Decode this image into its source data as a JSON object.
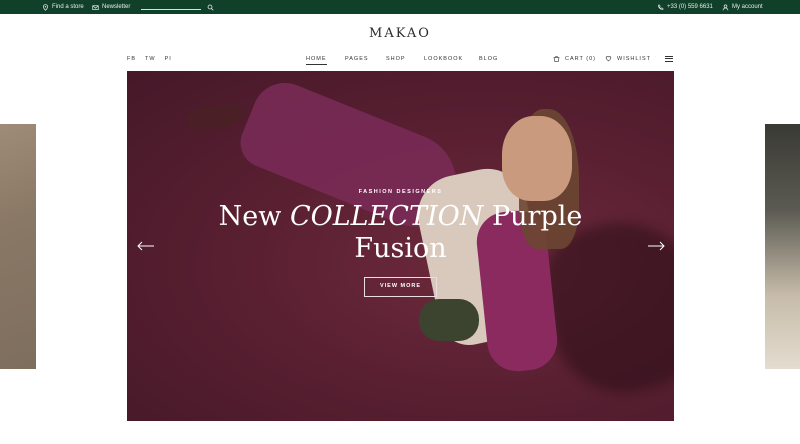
{
  "topbar": {
    "find_store": "Find a store",
    "newsletter": "Newsletter",
    "phone": "+33 (0) 559 6631",
    "account": "My account"
  },
  "header": {
    "logo": "MAKAO",
    "social": [
      "FB",
      "TW",
      "PI"
    ],
    "nav": [
      "HOME",
      "PAGES",
      "SHOP",
      "LOOKBOOK",
      "BLOG"
    ],
    "active_nav": "HOME",
    "cart": "CART (0)",
    "wishlist": "WISHLIST"
  },
  "hero": {
    "eyebrow": "FASHION DESIGNERS",
    "headline_part1": "New ",
    "headline_italic": "COLLECTION",
    "headline_part2": " Purple",
    "headline_line2": "Fusion",
    "button": "VIEW MORE"
  },
  "colors": {
    "topbar_bg": "#11402a",
    "hero_bg": "#5a2032"
  },
  "icons": [
    "location-pin-icon",
    "mail-icon",
    "search-icon",
    "phone-icon",
    "user-icon",
    "bag-icon",
    "heart-icon",
    "hamburger-menu-icon",
    "arrow-left-icon",
    "arrow-right-icon"
  ]
}
